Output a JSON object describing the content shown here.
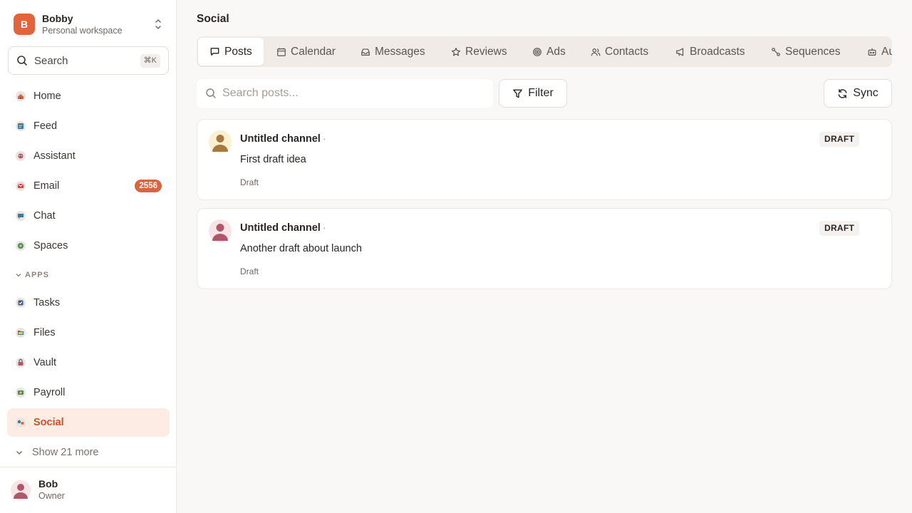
{
  "workspace": {
    "initial": "B",
    "name": "Bobby",
    "subtitle": "Personal workspace"
  },
  "search": {
    "label": "Search",
    "shortcut": "⌘K"
  },
  "nav": [
    {
      "label": "Home",
      "icon": "home-icon"
    },
    {
      "label": "Feed",
      "icon": "feed-icon"
    },
    {
      "label": "Assistant",
      "icon": "assistant-icon"
    },
    {
      "label": "Email",
      "icon": "email-icon",
      "badge": "2556"
    },
    {
      "label": "Chat",
      "icon": "chat-icon"
    },
    {
      "label": "Spaces",
      "icon": "spaces-icon"
    }
  ],
  "apps_section": {
    "label": "APPS"
  },
  "apps": [
    {
      "label": "Tasks",
      "icon": "tasks-icon"
    },
    {
      "label": "Files",
      "icon": "files-icon"
    },
    {
      "label": "Vault",
      "icon": "vault-icon"
    },
    {
      "label": "Payroll",
      "icon": "payroll-icon"
    },
    {
      "label": "Social",
      "icon": "social-icon",
      "active": true
    }
  ],
  "show_more": {
    "label": "Show 21 more"
  },
  "user": {
    "name": "Bob",
    "role": "Owner"
  },
  "page": {
    "title": "Social"
  },
  "tabs": [
    {
      "label": "Posts",
      "icon": "message-square-icon",
      "active": true
    },
    {
      "label": "Calendar",
      "icon": "calendar-icon"
    },
    {
      "label": "Messages",
      "icon": "inbox-icon"
    },
    {
      "label": "Reviews",
      "icon": "star-icon"
    },
    {
      "label": "Ads",
      "icon": "target-icon"
    },
    {
      "label": "Contacts",
      "icon": "users-icon"
    },
    {
      "label": "Broadcasts",
      "icon": "megaphone-icon"
    },
    {
      "label": "Sequences",
      "icon": "workflow-icon"
    },
    {
      "label": "Au",
      "icon": "robot-icon"
    }
  ],
  "toolbar": {
    "search_placeholder": "Search posts...",
    "filter_label": "Filter",
    "sync_label": "Sync"
  },
  "posts": [
    {
      "channel": "Untitled channel",
      "separator": "·",
      "text": "First draft idea",
      "status": "Draft",
      "badge": "DRAFT",
      "avatar_color": "#a57a3e",
      "avatar_bg": "#fbf0cf"
    },
    {
      "channel": "Untitled channel",
      "separator": "·",
      "text": "Another draft about launch",
      "status": "Draft",
      "badge": "DRAFT",
      "avatar_color": "#b0566a",
      "avatar_bg": "#f8e3e6"
    }
  ],
  "colors": {
    "accent": "#e0643c",
    "active_bg": "#fdece4",
    "active_text": "#c5532c",
    "badge": "#d9653e"
  }
}
